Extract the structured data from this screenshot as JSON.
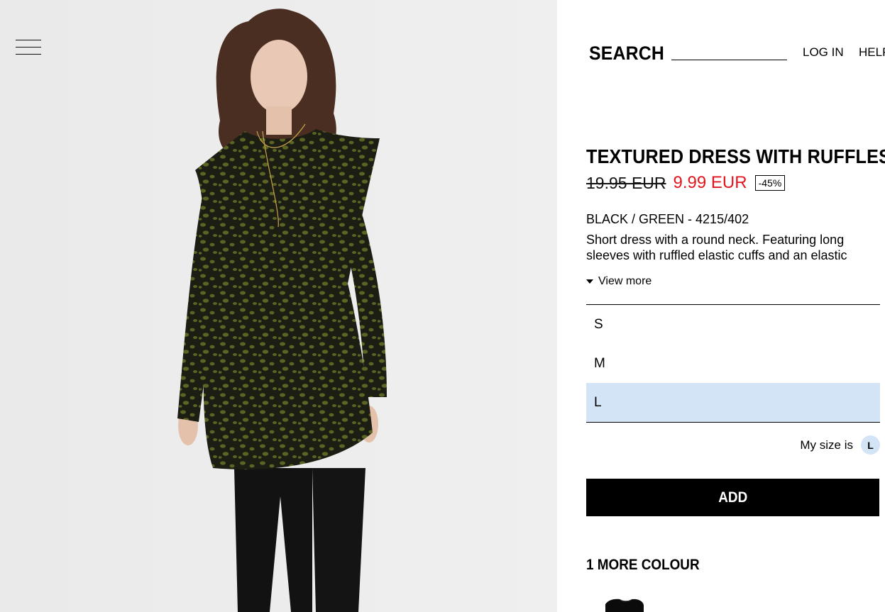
{
  "header": {
    "menu_icon": "hamburger-menu-icon",
    "search_label": "SEARCH",
    "nav_links": [
      "LOG IN",
      "HELP"
    ]
  },
  "product": {
    "title": "TEXTURED DRESS WITH RUFFLES",
    "old_price": "19.95 EUR",
    "new_price": "9.99 EUR",
    "discount": "-45%",
    "color_ref": "BLACK / GREEN - 4215/402",
    "description": "Short dress with a round neck. Featuring long sleeves with ruffled elastic cuffs and an elastic",
    "view_more": "View more",
    "sizes": [
      "S",
      "M",
      "L"
    ],
    "selected_size": "L",
    "my_size_label": "My size is",
    "my_size_value": "L",
    "add_button": "ADD",
    "more_colour": "1 MORE COLOUR"
  },
  "colors": {
    "sale_price": "#e1161e",
    "selected_size_bg": "#d4e4f7",
    "button_bg": "#000000"
  }
}
